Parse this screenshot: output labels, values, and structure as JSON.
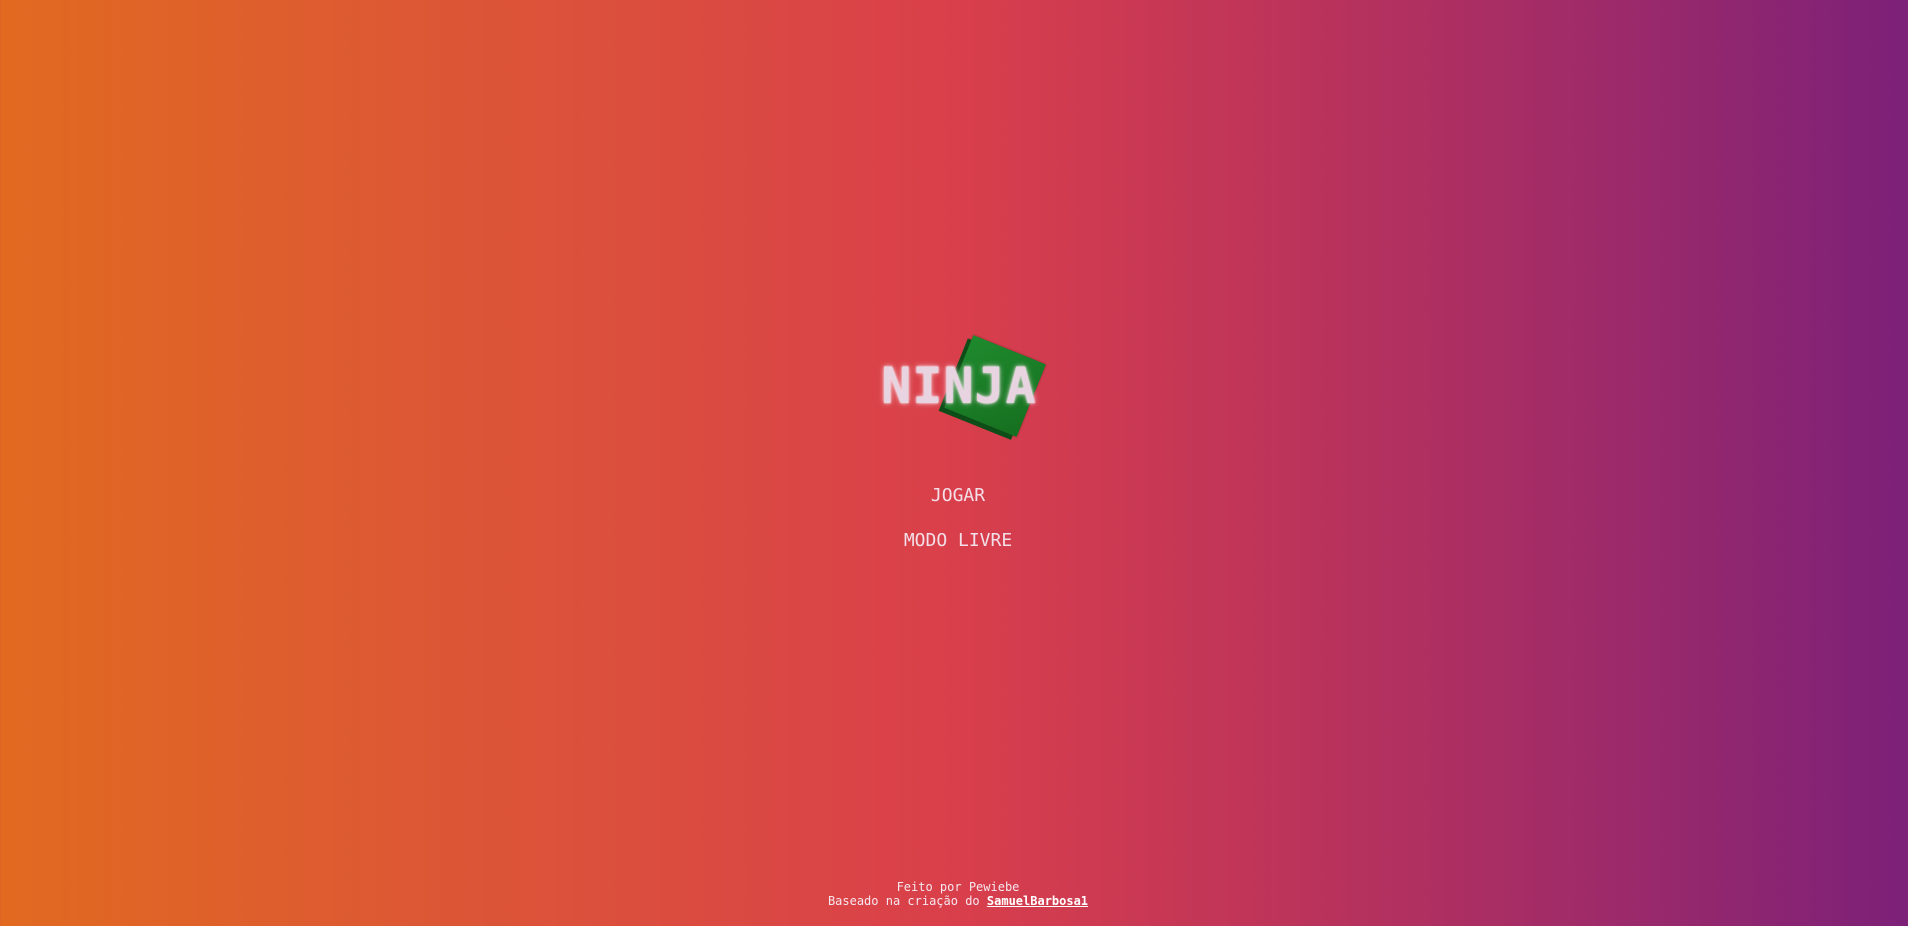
{
  "game": {
    "title": "NINJA",
    "logo_icon": "green-cube-icon",
    "accent_color": "#1d7d2a"
  },
  "menu": {
    "play_label": "JOGAR",
    "free_mode_label": "MODO LIVRE"
  },
  "footer": {
    "made_by": "Feito por Pewiebe",
    "based_on_prefix": "Baseado na criação do",
    "based_on_author": "SamuelBarbosa1"
  },
  "colors": {
    "gradient_left": "#e16a20",
    "gradient_mid": "#d93f4b",
    "gradient_right": "#7c2078",
    "text": "#f2dde6"
  }
}
